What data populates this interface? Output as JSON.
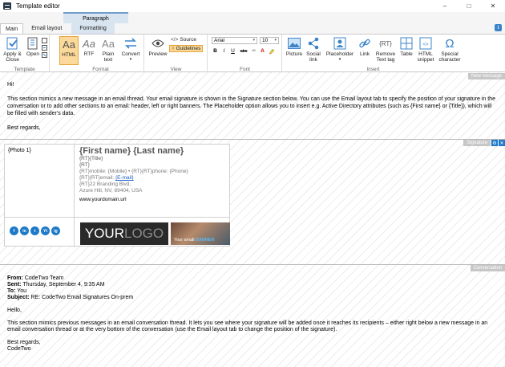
{
  "window": {
    "title": "Template editor",
    "controls": {
      "minimize": "–",
      "maximize": "□",
      "close": "✕"
    }
  },
  "ribbon": {
    "context_group": "Paragraph",
    "tabs": [
      {
        "label": "Main"
      },
      {
        "label": "Email layout"
      },
      {
        "label": "Formatting"
      }
    ],
    "groups": {
      "template": {
        "label": "Template",
        "apply_close": "Apply & Close",
        "open": "Open"
      },
      "format": {
        "label": "Format",
        "html": "HTML",
        "rtf": "RTF",
        "plain_text": "Plain text",
        "convert": "Convert"
      },
      "view": {
        "label": "View",
        "preview": "Preview",
        "source": "Source",
        "guidelines": "Guidelines"
      },
      "font": {
        "label": "Font",
        "family": "Arial",
        "size": "10",
        "bold": "B",
        "italic": "I",
        "underline": "U",
        "strike": "abc"
      },
      "insert": {
        "label": "Insert",
        "picture": "Picture",
        "social_link": "Social link",
        "placeholder": "Placeholder",
        "link": "Link",
        "remove_text_tag": "Remove Text tag",
        "table": "Table",
        "html_snippet": "HTML snippet",
        "special_character": "Special character"
      }
    },
    "accent_color": "#fbd99a"
  },
  "editor": {
    "new_message": {
      "tag": "New message",
      "greeting": "Hi!",
      "body": "This section mimics a new message in an email thread. Your email signature is shown in the Signature section below. You can use the Email layout tab to specify the position of your signature in the conversation or to add other sections to an email: header, left or right banners. The Placeholder option allows you to insert e.g. Active Directory attributes (such as {First name} or {Title}), which will be filled with sender's data.",
      "closing": "Best regards,"
    },
    "signature": {
      "tag": "Signature",
      "photo": "{Photo 1}",
      "name": "{First name} {Last name}",
      "title_line": "{RT}{Title}",
      "rt_line": "{RT}",
      "phone_line": "{RT}mobile: {Mobile} • {RT}{RT}phone: {Phone}",
      "email_prefix": "{RT}{RT}email: ",
      "email_link": "{E-mail}",
      "address1": "{RT}22 Branding Blvd,",
      "address2": "Azure Hill, NV, 89404, USA",
      "website": "www.yourdomain.url",
      "social_icons": [
        "f",
        "in",
        "t",
        "Yt",
        "ig"
      ],
      "logo_main": "YOUR",
      "logo_accent": "LOGO",
      "banner_prefix": "Your small ",
      "banner_accent": "BANNER"
    },
    "conversation": {
      "tag": "Conversation",
      "from_label": "From:",
      "from_value": " CodeTwo Team",
      "sent_label": "Sent:",
      "sent_value": " Thursday, September 4, 9:35 AM",
      "to_label": "To:",
      "to_value": " You",
      "subject_label": "Subject:",
      "subject_value": " RE: CodeTwo Email Signatures On-prem",
      "greeting": "Hello,",
      "body": "This section mimics previous messages in an email conversation thread. It lets you see where your signature will be added once it reaches its recipients – either right below a new message in an email conversation thread or at the very bottom of the conversation (use the Email layout tab to change the position of the signature).",
      "closing1": "Best regards,",
      "closing2": "CodeTwo"
    }
  }
}
